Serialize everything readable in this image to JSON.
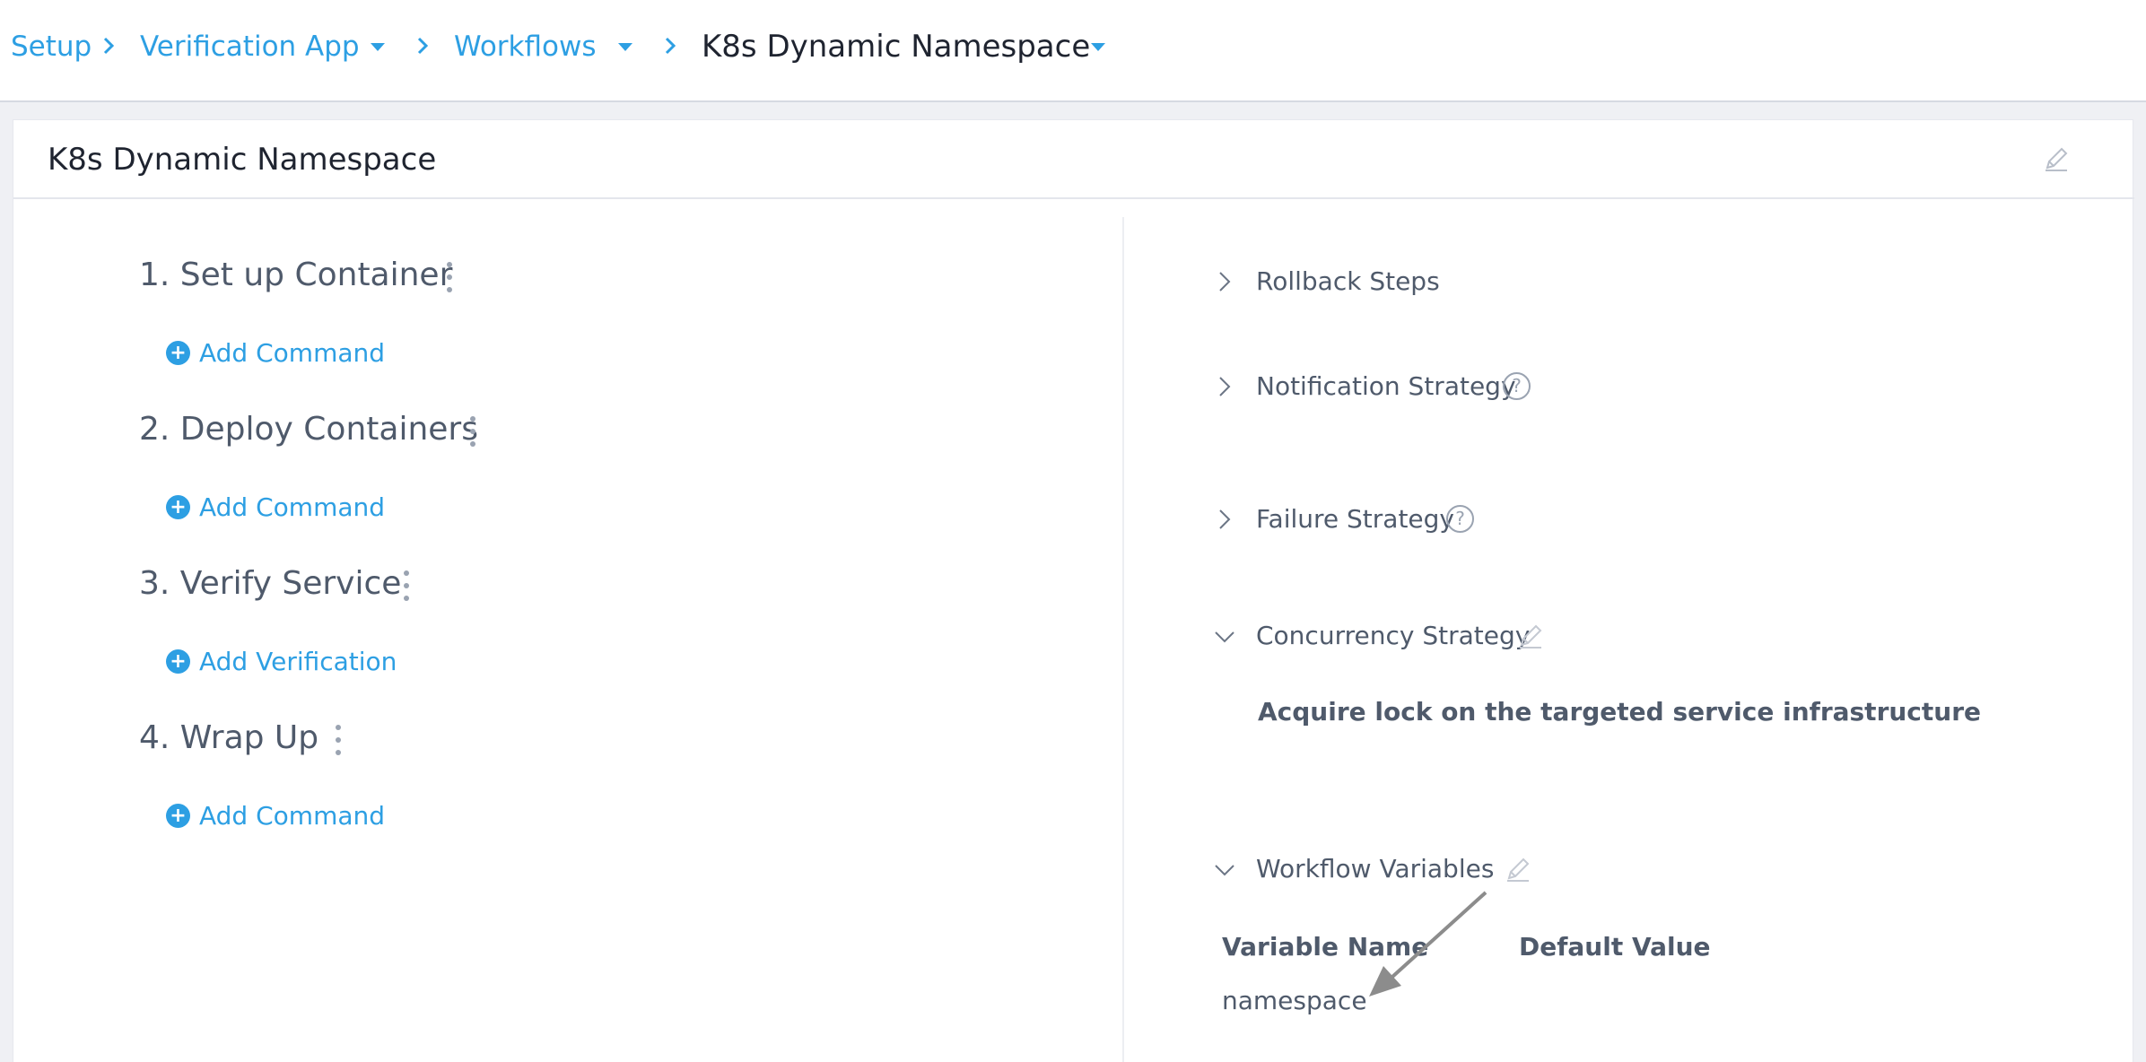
{
  "breadcrumb": {
    "setup": "Setup",
    "app": "Verification App",
    "workflows": "Workflows",
    "current": "K8s Dynamic Namespace"
  },
  "card": {
    "title": "K8s Dynamic Namespace"
  },
  "steps": [
    {
      "title": "1. Set up Container",
      "action": "Add Command"
    },
    {
      "title": "2. Deploy Containers",
      "action": "Add Command"
    },
    {
      "title": "3. Verify Service",
      "action": "Add Verification"
    },
    {
      "title": "4. Wrap Up",
      "action": "Add Command"
    }
  ],
  "sections": {
    "rollback": "Rollback Steps",
    "notification": "Notification Strategy",
    "failure": "Failure Strategy",
    "concurrency": "Concurrency Strategy",
    "concurrency_value": "Acquire lock on the targeted service infrastructure",
    "variables": "Workflow Variables"
  },
  "variables_table": {
    "headers": [
      "Variable Name",
      "Default Value"
    ],
    "rows": [
      [
        "namespace",
        ""
      ]
    ]
  },
  "help_glyph": "?",
  "plus_glyph": "+",
  "colors": {
    "link": "#2d9fe3",
    "text": "#4f5a6b",
    "dark_text": "#1f2430",
    "icon_gray": "#9aa3b1"
  }
}
